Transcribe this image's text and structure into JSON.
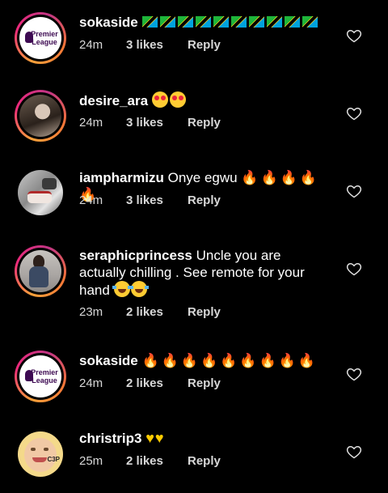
{
  "comments": [
    {
      "username": "sokaside",
      "text": "",
      "emoji": "tanzania-flag x10",
      "time": "24m",
      "likes": "3 likes",
      "reply": "Reply",
      "avatar": "Premier League"
    },
    {
      "username": "desire_ara",
      "text": "",
      "emoji": "heart-eyes x2",
      "time": "24m",
      "likes": "3 likes",
      "reply": "Reply"
    },
    {
      "username": "iampharmizu",
      "text": "Onye egwu",
      "emoji": "fire x5",
      "time": "24m",
      "likes": "3 likes",
      "reply": "Reply"
    },
    {
      "username": "seraphicprincess",
      "text_line1": "Uncle you are",
      "text_line2": "actually chilling . See remote for your",
      "text_line3": "hand",
      "emoji": "tears-of-joy x2",
      "time": "23m",
      "likes": "2 likes",
      "reply": "Reply"
    },
    {
      "username": "sokaside",
      "text": "",
      "emoji": "fire x9",
      "time": "24m",
      "likes": "2 likes",
      "reply": "Reply",
      "avatar": "Premier League"
    },
    {
      "username": "christrip3",
      "text": "",
      "emoji": "yellow-heart x2",
      "time": "25m",
      "likes": "2 likes",
      "reply": "Reply",
      "avatar_text": "C3P"
    }
  ],
  "colors": {
    "background": "#000000",
    "text": "#ffffff",
    "meta": "#d8d8d8",
    "ring_start": "#f9a13a",
    "ring_end": "#c13584",
    "premier_league_purple": "#3d0a52"
  },
  "icons": {
    "like": "heart-outline-icon"
  }
}
